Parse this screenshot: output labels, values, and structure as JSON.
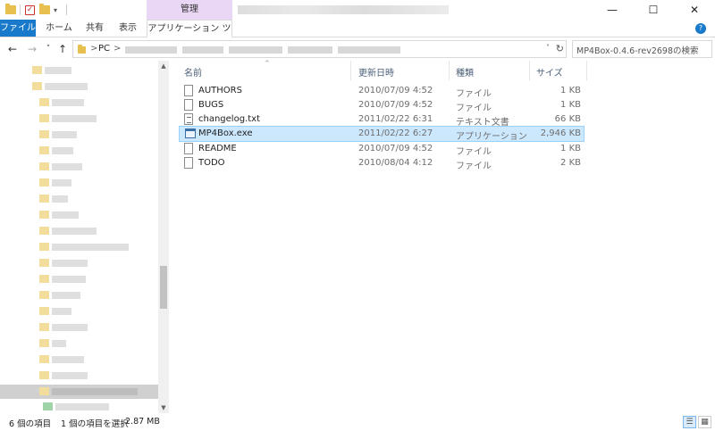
{
  "window": {
    "context_tab_header": "管理",
    "controls": {
      "minimize": "—",
      "maximize": "☐",
      "close": "✕"
    }
  },
  "ribbon": {
    "tabs": [
      {
        "label": "ファイル",
        "active": true
      },
      {
        "label": "ホーム"
      },
      {
        "label": "共有"
      },
      {
        "label": "表示"
      },
      {
        "label": "アプリケーション ツール"
      }
    ],
    "help": "?"
  },
  "nav": {
    "back": "←",
    "forward": "→",
    "recent": "˅",
    "up": "↑"
  },
  "address": {
    "root": "PC",
    "separator": ">",
    "dropdown": "˅",
    "refresh": "↻"
  },
  "search": {
    "placeholder": "MP4Box-0.4.6-rev2698の検索"
  },
  "columns": {
    "name": "名前",
    "date": "更新日時",
    "type": "種類",
    "size": "サイズ"
  },
  "files": [
    {
      "name": "AUTHORS",
      "date": "2010/07/09 4:52",
      "type": "ファイル",
      "size": "1 KB",
      "icon": "document-icon"
    },
    {
      "name": "BUGS",
      "date": "2010/07/09 4:52",
      "type": "ファイル",
      "size": "1 KB",
      "icon": "document-icon"
    },
    {
      "name": "changelog.txt",
      "date": "2011/02/22 6:31",
      "type": "テキスト文書",
      "size": "66 KB",
      "icon": "text-file-icon"
    },
    {
      "name": "MP4Box.exe",
      "date": "2011/02/22 6:27",
      "type": "アプリケーション",
      "size": "2,946 KB",
      "icon": "application-icon",
      "selected": true
    },
    {
      "name": "README",
      "date": "2010/07/09 4:52",
      "type": "ファイル",
      "size": "1 KB",
      "icon": "document-icon"
    },
    {
      "name": "TODO",
      "date": "2010/08/04 4:12",
      "type": "ファイル",
      "size": "2 KB",
      "icon": "document-icon"
    }
  ],
  "status": {
    "item_count": "6 個の項目",
    "selection": "1 個の項目を選択",
    "selection_size": "2.87 MB"
  },
  "colors": {
    "accent": "#1979ca",
    "context_tab": "#ead6f5",
    "selection": "#cce8ff"
  }
}
